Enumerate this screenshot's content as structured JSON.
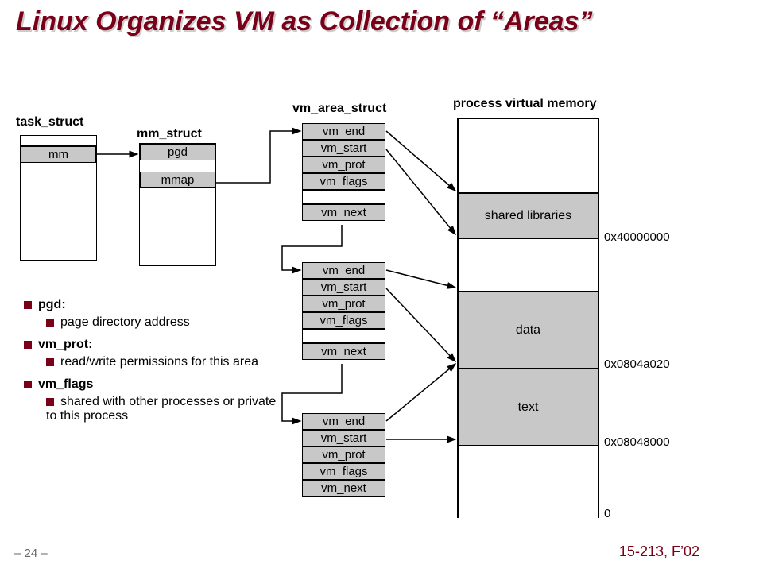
{
  "title": "Linux Organizes VM as Collection of “Areas”",
  "labels": {
    "task": "task_struct",
    "mm_struct": "mm_struct",
    "vmarea": "vm_area_struct",
    "pvm": "process virtual memory"
  },
  "task": {
    "mm": "mm"
  },
  "mm": {
    "pgd": "pgd",
    "mmap": "mmap"
  },
  "vm": {
    "end": "vm_end",
    "start": "vm_start",
    "prot": "vm_prot",
    "flags": "vm_flags",
    "next": "vm_next"
  },
  "memory": {
    "shared": "shared libraries",
    "data": "data",
    "text": "text"
  },
  "addr": {
    "shared": "0x40000000",
    "data": "0x0804a020",
    "text": "0x08048000",
    "zero": "0"
  },
  "notes": {
    "pgd_h": "pgd:",
    "pgd_b": "page directory address",
    "prot_h": "vm_prot:",
    "prot_b": "read/write permissions for this area",
    "flags_h": "vm_flags",
    "flags_b": "shared with other processes or private to this process"
  },
  "footer": {
    "page": "– 24 –",
    "course": "15-213, F’02"
  }
}
